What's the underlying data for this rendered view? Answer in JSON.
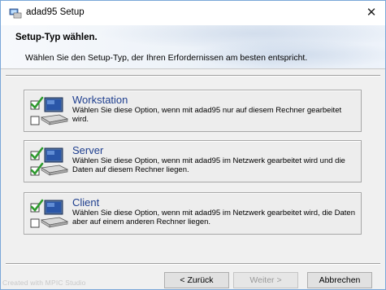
{
  "window": {
    "title": "adad95 Setup",
    "close_glyph": "✕"
  },
  "header": {
    "title": "Setup-Typ wählen.",
    "subtitle": "Wählen Sie den Setup-Typ, der Ihren Erfordernissen am besten entspricht."
  },
  "options": [
    {
      "name": "Workstation",
      "icon": "computer-check-icon",
      "description": "Wählen Sie diese Option, wenn mit adad95 nur auf diesem Rechner gearbeitet wird.",
      "checks": [
        true,
        false
      ]
    },
    {
      "name": "Server",
      "icon": "computer-check-icon",
      "description": "Wählen Sie diese Option, wenn mit adad95 im Netzwerk gearbeitet wird und die Daten auf diesem Rechner liegen.",
      "checks": [
        true,
        true
      ]
    },
    {
      "name": "Client",
      "icon": "computer-check-icon",
      "description": "Wählen Sie diese Option, wenn mit adad95 im Netzwerk gearbeitet wird, die Daten aber auf einem anderen Rechner liegen.",
      "checks": [
        true,
        false
      ]
    }
  ],
  "footer": {
    "watermark": "Created with MPIC Studio",
    "back_label": "< Zurück",
    "next_label": "Weiter >",
    "next_enabled": false,
    "cancel_label": "Abbrechen"
  },
  "colors": {
    "option_title": "#1f3f8f",
    "check_green": "#2e9a2e",
    "window_border": "#7aa7d8"
  }
}
